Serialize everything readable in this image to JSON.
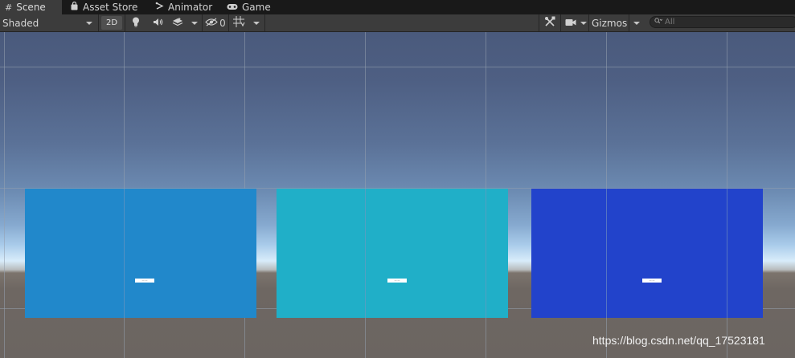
{
  "tabs": [
    {
      "label": "Scene",
      "icon": "hash-grid-icon"
    },
    {
      "label": "Asset Store",
      "icon": "shopping-bag-icon"
    },
    {
      "label": "Animator",
      "icon": "animator-icon"
    },
    {
      "label": "Game",
      "icon": "gamepad-icon"
    }
  ],
  "toolbar": {
    "shading_mode": "Shaded",
    "btn_2d": "2D",
    "hidden_count": "0",
    "gizmos_label": "Gizmos",
    "search_placeholder": "All"
  },
  "scene": {
    "panels": [
      {
        "color": "#2188cb"
      },
      {
        "color": "#20afc8"
      },
      {
        "color": "#2243cb"
      }
    ]
  },
  "watermark": "https://blog.csdn.net/qq_17523181"
}
